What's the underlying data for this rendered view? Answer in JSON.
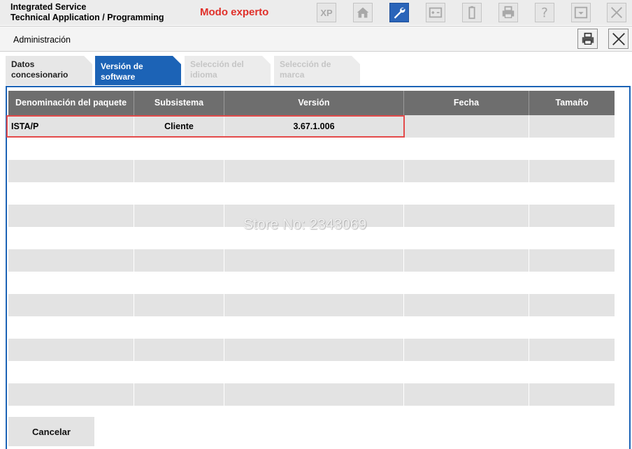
{
  "app": {
    "title_line1": "Integrated Service",
    "title_line2": "Technical Application / Programming",
    "mode": "Modo experto",
    "accent": "#1c63b6",
    "mode_color": "#e0302a"
  },
  "toolbar": {
    "xp_label": "XP",
    "icons": [
      "xp-icon",
      "home-icon",
      "wrench-icon",
      "calculator-icon",
      "battery-icon",
      "print-icon",
      "help-icon",
      "minimize-window-icon",
      "close-icon"
    ]
  },
  "admin": {
    "title": "Administración",
    "icons": [
      "print-icon",
      "close-icon"
    ]
  },
  "tabs": [
    {
      "label_line1": "Datos",
      "label_line2": "concesionario"
    },
    {
      "label_line1": "Versión de",
      "label_line2": "software"
    },
    {
      "label_line1": "Selección del",
      "label_line2": "idioma"
    },
    {
      "label_line1": "Selección de",
      "label_line2": "marca"
    }
  ],
  "table": {
    "columns": [
      "Denominación del paquete",
      "Subsistema",
      "Versión",
      "Fecha",
      "Tamaño"
    ],
    "rows": [
      [
        "ISTA/P",
        "Cliente",
        "3.67.1.006",
        "",
        ""
      ]
    ]
  },
  "watermark": "Store No: 2343069",
  "cancel_label": "Cancelar"
}
